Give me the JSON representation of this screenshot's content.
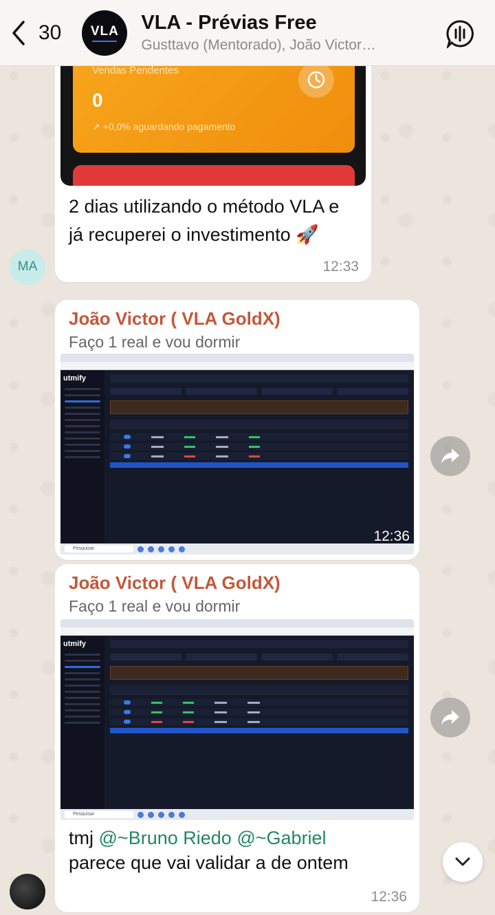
{
  "header": {
    "back_count": "30",
    "avatar_logo_text": "VLA",
    "title": "VLA - Prévias Free",
    "members": "Gusttavo (Mentorado), João Victor…"
  },
  "messages": [
    {
      "card_title": "Vendas Pendentes",
      "card_value": "0",
      "card_trend": "↗ +0,0%  aguardando pagamento",
      "text": "2 dias utilizando o método VLA e já recuperei o investimento 🚀",
      "time": "12:33",
      "avatar_initials": "MA"
    },
    {
      "sender": "João Victor ( VLA GoldX)",
      "quote": "Faço 1 real e vou dormir",
      "app_logo": "utmify",
      "taskbar_search": "Pesquisar",
      "time": "12:36"
    },
    {
      "sender": "João Victor ( VLA GoldX)",
      "quote": "Faço 1 real e vou dormir",
      "app_logo": "utmify",
      "taskbar_search": "Pesquisar",
      "mention1": "@~Bruno Riedo",
      "mention2": "@~Gabriel",
      "text_prefix": "tmj",
      "text_line2": "parece que vai validar a de ontem",
      "time": "12:36"
    }
  ],
  "icons": {
    "back": "chevron-left-icon",
    "voice": "voice-chat-icon",
    "forward": "forward-icon",
    "scroll": "chevron-down-icon",
    "clock": "clock-icon"
  },
  "colors": {
    "sender_name": "#c4573a",
    "mention": "#23875f",
    "card_orange": "#f7a51b",
    "card_red": "#e23a3a"
  }
}
